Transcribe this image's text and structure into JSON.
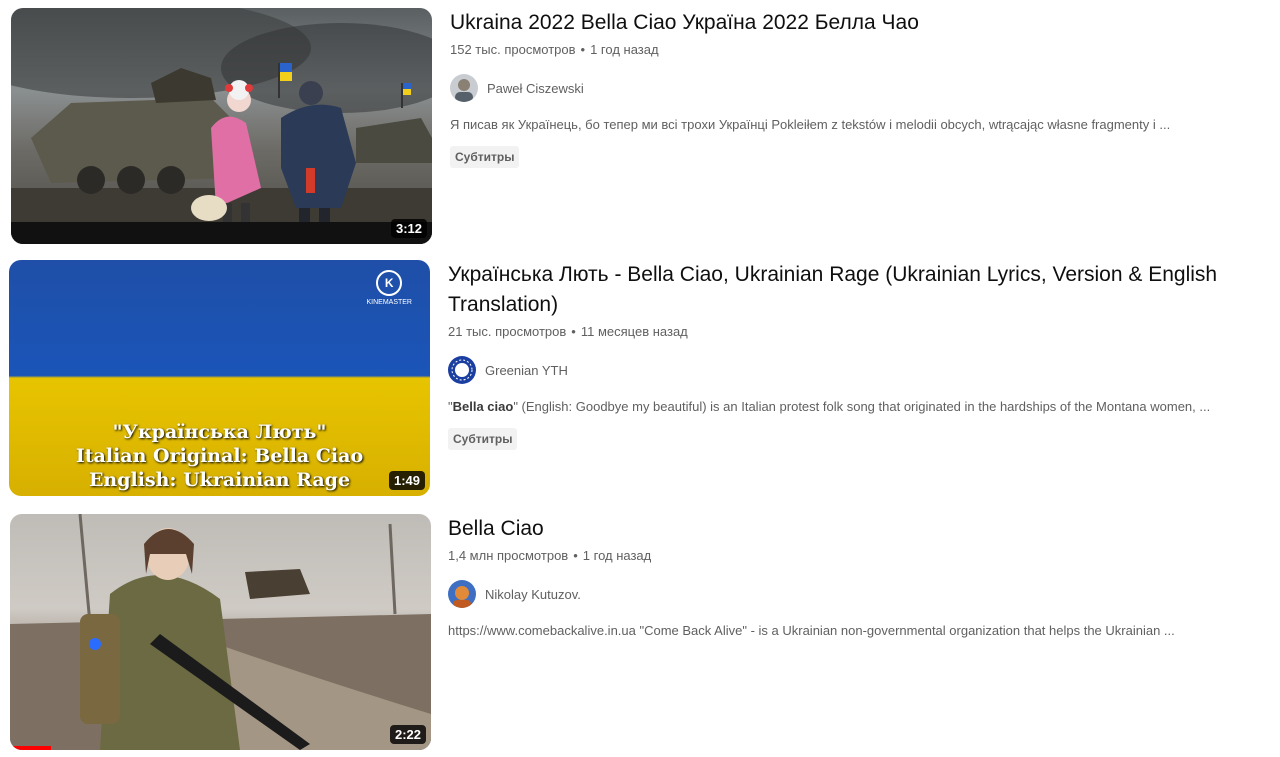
{
  "results": [
    {
      "title": "Ukraina 2022 Bella Ciao Україна 2022 Белла Чао",
      "views": "152 тыс. просмотров",
      "age": "1 год назад",
      "channel": "Paweł Ciszewski",
      "description": "Я писав як Українець, бо тепер ми всі трохи Українці Pokleiłem z tekstów i melodii obcych, wtrącając własne fragmenty i ...",
      "badge": "Субтитры",
      "duration": "3:12"
    },
    {
      "title": "Українська Лють - Bella Ciao, Ukrainian Rage (Ukrainian Lyrics, Version & English Translation)",
      "views": "21 тыс. просмотров",
      "age": "11 месяцев назад",
      "channel": "Greenian YTH",
      "description_bold": "Bella ciao",
      "description_open_quote": "\"",
      "description_rest": "\" (English: Goodbye my beautiful) is an Italian protest folk song that originated in the hardships of the Montana women, ...",
      "badge": "Субтитры",
      "duration": "1:49",
      "thumb_caption": [
        "\"Українська Лють\"",
        "Italian Original: Bella Ciao",
        "English: Ukrainian Rage"
      ],
      "thumb_watermark": "KINEMASTER"
    },
    {
      "title": "Bella Ciao",
      "views": "1,4 млн просмотров",
      "age": "1 год назад",
      "channel": "Nikolay Kutuzov.",
      "description": "https://www.comebackalive.in.ua \"Come Back Alive\" - is a Ukrainian non-governmental organization that helps the Ukrainian ...",
      "duration": "2:22",
      "watch_progress": 0.1
    }
  ],
  "separator": "•",
  "colors": {
    "flag_blue": "#1a55b8",
    "flag_yellow": "#e7c400",
    "progress_red": "#ff0000"
  }
}
